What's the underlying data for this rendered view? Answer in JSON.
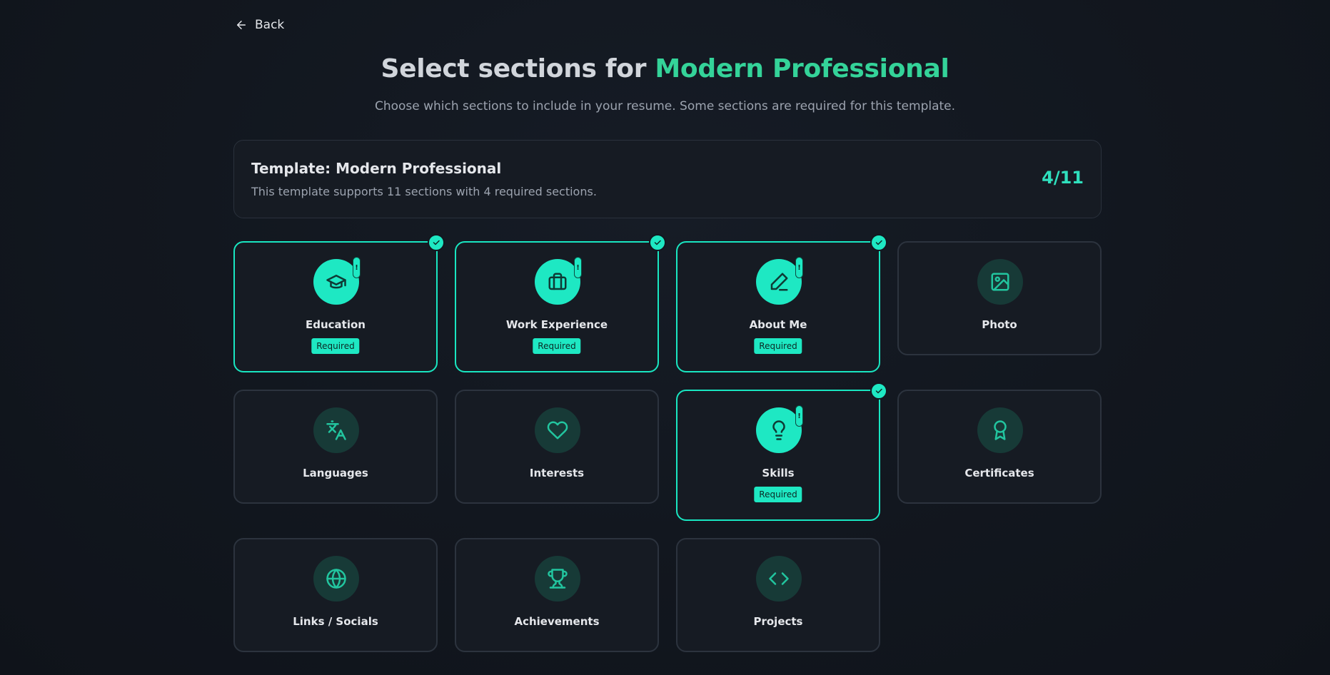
{
  "nav": {
    "back_label": "Back"
  },
  "header": {
    "title_prefix": "Select sections for ",
    "title_accent": "Modern Professional",
    "subtitle": "Choose which sections to include in your resume. Some sections are required for this template."
  },
  "template_info": {
    "title": "Template: Modern Professional",
    "description": "This template supports 11 sections with 4 required sections.",
    "count": "4/11"
  },
  "required_badge": "Required",
  "required_marker": "!",
  "sections": [
    {
      "label": "Education",
      "icon": "graduation-cap-icon",
      "selected": true,
      "required": true
    },
    {
      "label": "Work Experience",
      "icon": "briefcase-icon",
      "selected": true,
      "required": true
    },
    {
      "label": "About Me",
      "icon": "pen-icon",
      "selected": true,
      "required": true
    },
    {
      "label": "Photo",
      "icon": "image-icon",
      "selected": false,
      "required": false
    },
    {
      "label": "Languages",
      "icon": "translate-icon",
      "selected": false,
      "required": false
    },
    {
      "label": "Interests",
      "icon": "heart-icon",
      "selected": false,
      "required": false
    },
    {
      "label": "Skills",
      "icon": "lightbulb-icon",
      "selected": true,
      "required": true
    },
    {
      "label": "Certificates",
      "icon": "award-icon",
      "selected": false,
      "required": false
    },
    {
      "label": "Links / Socials",
      "icon": "globe-icon",
      "selected": false,
      "required": false
    },
    {
      "label": "Achievements",
      "icon": "trophy-icon",
      "selected": false,
      "required": false
    },
    {
      "label": "Projects",
      "icon": "code-icon",
      "selected": false,
      "required": false
    }
  ],
  "colors": {
    "accent": "#1ee8c3",
    "title_accent": "#34d399",
    "background": "#12171f",
    "card": "#161b23"
  }
}
